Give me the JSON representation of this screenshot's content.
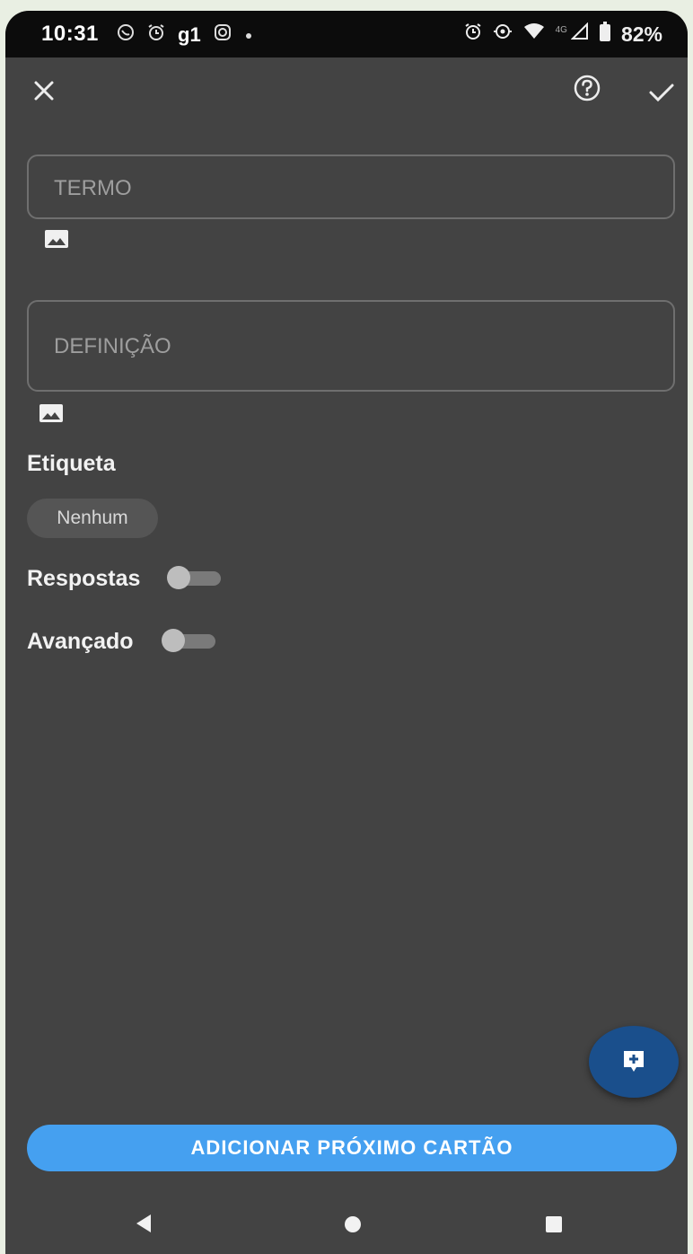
{
  "status_bar": {
    "time": "10:31",
    "left_icons": [
      "whatsapp-icon",
      "alarm-icon",
      "g1-app-icon",
      "instagram-icon",
      "dot-icon"
    ],
    "g1_label": "g1",
    "network_label": "4G",
    "battery": "82%"
  },
  "toolbar": {
    "close_icon": "close-icon",
    "help_icon": "help-circle-icon",
    "confirm_icon": "check-icon"
  },
  "form": {
    "term_placeholder": "TERMO",
    "definition_placeholder": "DEFINIÇÃO",
    "tag_label": "Etiqueta",
    "tag_value": "Nenhum",
    "answers_label": "Respostas",
    "answers_enabled": false,
    "advanced_label": "Avançado",
    "advanced_enabled": false
  },
  "actions": {
    "fab_icon": "add-card-icon",
    "next_card_label": "ADICIONAR PRÓXIMO CARTÃO"
  },
  "nav": {
    "back_icon": "back-triangle-icon",
    "home_icon": "home-circle-icon",
    "recents_icon": "recents-square-icon"
  },
  "colors": {
    "background": "#434343",
    "status_bar": "#0c0c0c",
    "cta": "#45a0f0",
    "fab": "#1a4f8c"
  }
}
